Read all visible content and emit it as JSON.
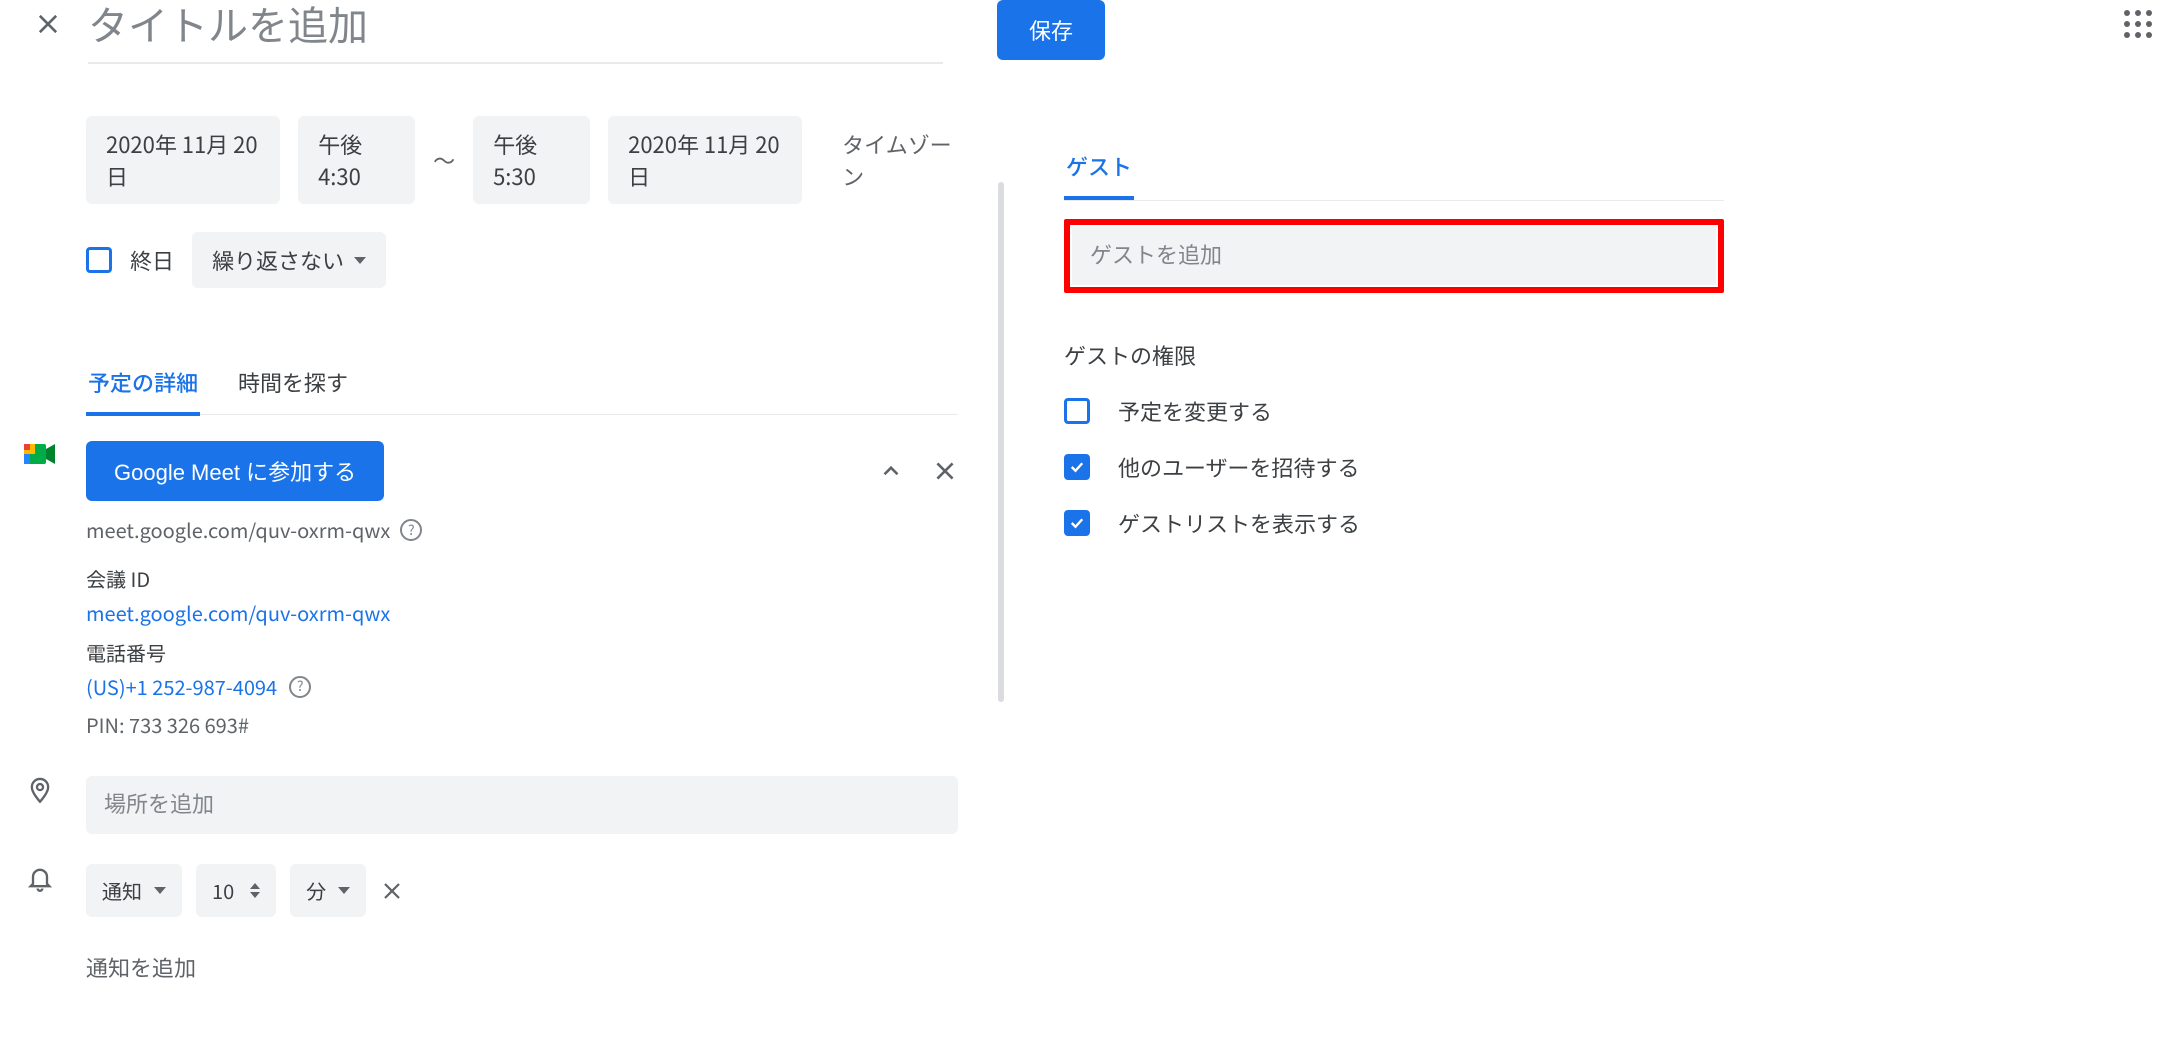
{
  "header": {
    "title_placeholder": "タイトルを追加",
    "save_label": "保存"
  },
  "datetime": {
    "start_date": "2020年 11月 20日",
    "start_time": "午後4:30",
    "separator": "〜",
    "end_time": "午後5:30",
    "end_date": "2020年 11月 20日",
    "timezone_label": "タイムゾーン"
  },
  "allday": {
    "label": "終日",
    "repeat_label": "繰り返さない"
  },
  "tabs": {
    "details": "予定の詳細",
    "find_time": "時間を探す"
  },
  "meet": {
    "join_label": "Google Meet に参加する",
    "url_display": "meet.google.com/quv-oxrm-qwx",
    "meeting_id_label": "会議 ID",
    "meeting_id_link": "meet.google.com/quv-oxrm-qwx",
    "phone_label": "電話番号",
    "phone_link": "(US)+1 252-987-4094",
    "pin_line": "PIN: 733 326 693#"
  },
  "location": {
    "placeholder": "場所を追加"
  },
  "notification": {
    "type_label": "通知",
    "value": "10",
    "unit_label": "分",
    "add_label": "通知を追加"
  },
  "guests": {
    "tab_label": "ゲスト",
    "input_placeholder": "ゲストを追加",
    "permissions_title": "ゲストの権限",
    "perm_modify": "予定を変更する",
    "perm_invite": "他のユーザーを招待する",
    "perm_see": "ゲストリストを表示する"
  }
}
